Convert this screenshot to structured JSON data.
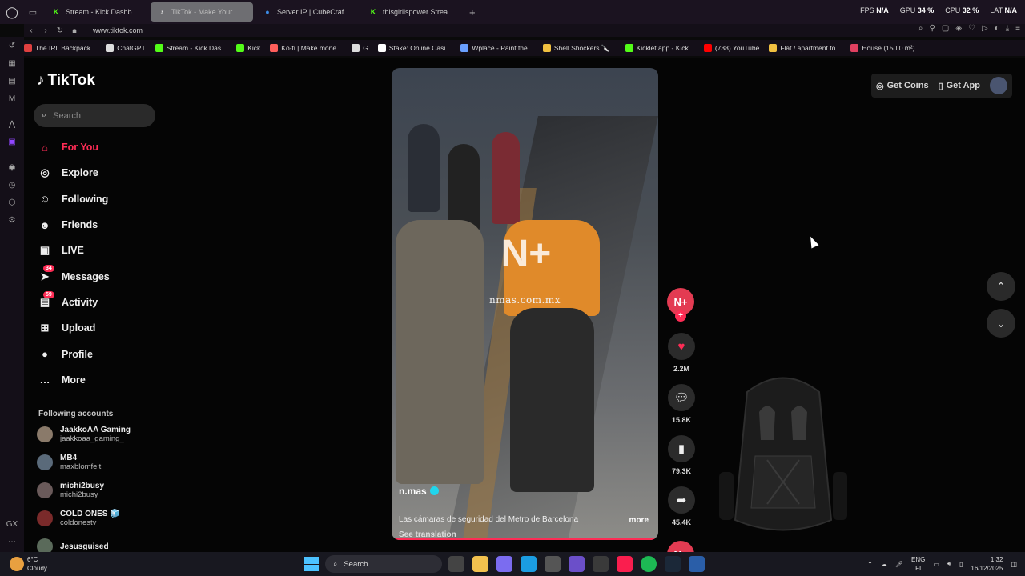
{
  "browser": {
    "tabs": [
      {
        "label": "Stream - Kick Dashboard",
        "icon": "kick-icon",
        "color": "#53fc18",
        "active": false
      },
      {
        "label": "TikTok - Make Your Day",
        "icon": "tiktok-icon",
        "color": "#000000",
        "active": true
      },
      {
        "label": "Server IP | CubeCraft Ga",
        "icon": "cubecraft-icon",
        "color": "#3c8ce7",
        "active": false
      },
      {
        "label": "thisgirlispower Stream - V",
        "icon": "kick-icon",
        "color": "#53fc18",
        "active": false
      }
    ],
    "new_tab": "+",
    "stats": {
      "fps_label": "FPS",
      "fps_value": "N/A",
      "gpu_label": "GPU",
      "gpu_value": "34 %",
      "cpu_label": "CPU",
      "cpu_value": "32 %",
      "lat_label": "LAT",
      "lat_value": "N/A"
    },
    "url": "www.tiktok.com",
    "bookmarks": [
      {
        "label": "The IRL Backpack...",
        "color": "#e04040"
      },
      {
        "label": "ChatGPT",
        "color": "#dddddd"
      },
      {
        "label": "Stream - Kick Das...",
        "color": "#53fc18"
      },
      {
        "label": "Kick",
        "color": "#53fc18"
      },
      {
        "label": "Ko-fi | Make mone...",
        "color": "#ff5e5b"
      },
      {
        "label": "G",
        "color": "#dddddd"
      },
      {
        "label": "Stake: Online Casi...",
        "color": "#ffffff"
      },
      {
        "label": "Wplace - Paint the...",
        "color": "#6aa0ff"
      },
      {
        "label": "Shell Shockers 🔪...",
        "color": "#f0c040"
      },
      {
        "label": "Kicklet.app - Kick...",
        "color": "#53fc18"
      },
      {
        "label": "(738) YouTube",
        "color": "#ff0000"
      },
      {
        "label": "Flat / apartment fo...",
        "color": "#f0c040"
      },
      {
        "label": "House (150.0 m²)...",
        "color": "#e04060"
      }
    ]
  },
  "tiktok": {
    "logo": "TikTok",
    "search_placeholder": "Search",
    "nav": [
      {
        "label": "For You",
        "icon": "home-icon",
        "glyph": "⌂",
        "active": true,
        "badge": ""
      },
      {
        "label": "Explore",
        "icon": "compass-icon",
        "glyph": "◎",
        "active": false,
        "badge": ""
      },
      {
        "label": "Following",
        "icon": "following-icon",
        "glyph": "☺",
        "active": false,
        "badge": ""
      },
      {
        "label": "Friends",
        "icon": "friends-icon",
        "glyph": "☻",
        "active": false,
        "badge": ""
      },
      {
        "label": "LIVE",
        "icon": "live-icon",
        "glyph": "▣",
        "active": false,
        "badge": ""
      },
      {
        "label": "Messages",
        "icon": "messages-icon",
        "glyph": "➤",
        "active": false,
        "badge": "34"
      },
      {
        "label": "Activity",
        "icon": "activity-icon",
        "glyph": "▤",
        "active": false,
        "badge": "59"
      },
      {
        "label": "Upload",
        "icon": "upload-icon",
        "glyph": "⊞",
        "active": false,
        "badge": ""
      },
      {
        "label": "Profile",
        "icon": "profile-icon",
        "glyph": "●",
        "active": false,
        "badge": ""
      },
      {
        "label": "More",
        "icon": "more-icon",
        "glyph": "…",
        "active": false,
        "badge": ""
      }
    ],
    "following_title": "Following accounts",
    "following": [
      {
        "name": "JaakkoAA Gaming",
        "handle": "jaakkoaa_gaming_"
      },
      {
        "name": "MB4",
        "handle": "maxblomfelt"
      },
      {
        "name": "michi2busy",
        "handle": "michi2busy"
      },
      {
        "name": "COLD ONES 🧊",
        "handle": "coldonestv"
      },
      {
        "name": "Jesusguised",
        "handle": ""
      }
    ],
    "video": {
      "watermark": "N+",
      "watermark_text": "nmas.com.mx",
      "author": "n.mas",
      "caption": "Las cámaras de seguridad del Metro de Barcelona",
      "more": "more",
      "translate": "See translation"
    },
    "actions": {
      "likes": "2.2M",
      "comments": "15.8K",
      "saves": "79.3K",
      "shares": "45.4K"
    },
    "header": {
      "get_coins": "Get Coins",
      "get_app": "Get App"
    }
  },
  "taskbar": {
    "temp": "6°C",
    "weather": "Cloudy",
    "search": "Search",
    "lang1": "ENG",
    "lang2": "FI",
    "time": "1.32",
    "date": "16/12/2025"
  }
}
